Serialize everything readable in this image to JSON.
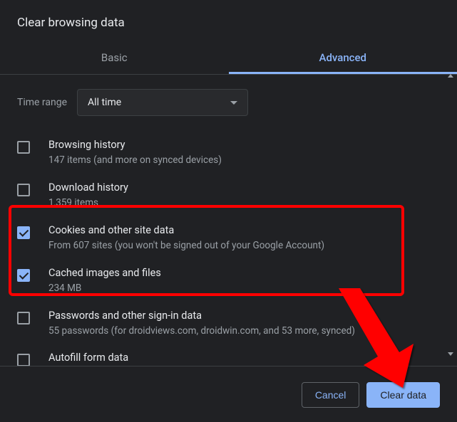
{
  "dialog": {
    "title": "Clear browsing data"
  },
  "tabs": {
    "basic": "Basic",
    "advanced": "Advanced"
  },
  "timeRange": {
    "label": "Time range",
    "value": "All time"
  },
  "items": [
    {
      "title": "Browsing history",
      "sub": "147 items (and more on synced devices)",
      "checked": false
    },
    {
      "title": "Download history",
      "sub": "1,359 items",
      "checked": false
    },
    {
      "title": "Cookies and other site data",
      "sub": "From 607 sites (you won't be signed out of your Google Account)",
      "checked": true
    },
    {
      "title": "Cached images and files",
      "sub": "234 MB",
      "checked": true
    },
    {
      "title": "Passwords and other sign-in data",
      "sub": "55 passwords (for droidviews.com, droidwin.com, and 53 more, synced)",
      "checked": false
    },
    {
      "title": "Autofill form data",
      "sub": "",
      "checked": false
    }
  ],
  "actions": {
    "cancel": "Cancel",
    "clear": "Clear data"
  }
}
